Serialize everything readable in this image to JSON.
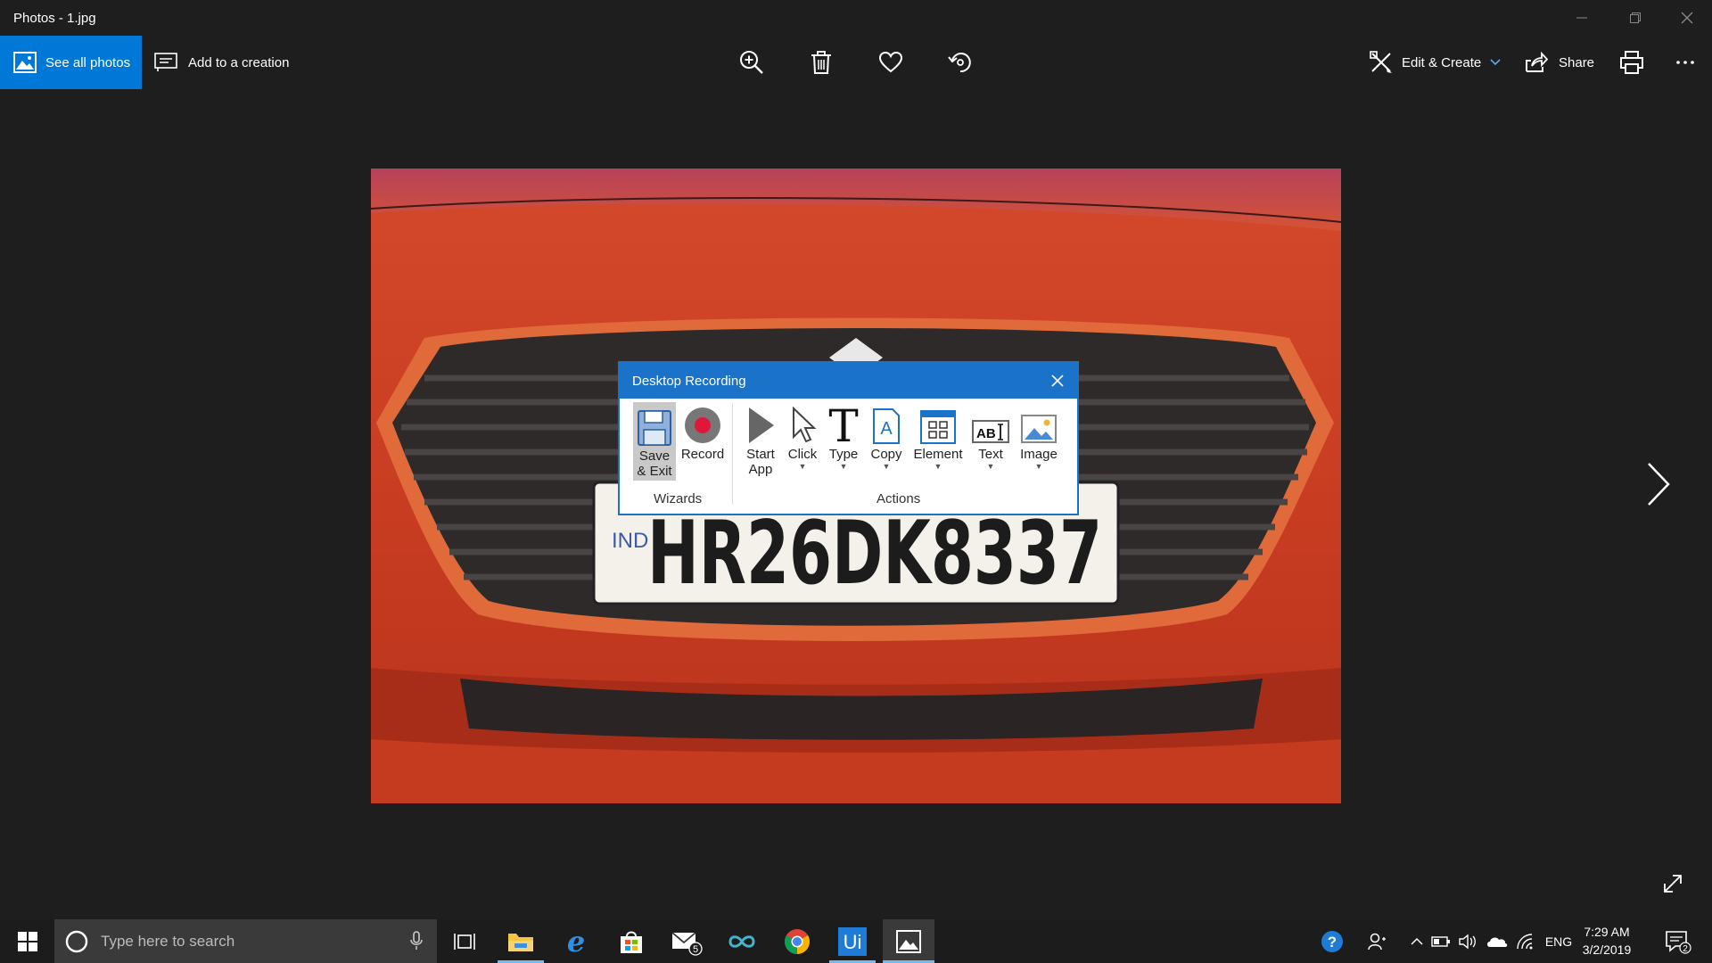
{
  "window": {
    "title": "Photos - 1.jpg"
  },
  "toolbar": {
    "see_all_label": "See all photos",
    "add_creation_label": "Add to a creation",
    "edit_create_label": "Edit & Create",
    "share_label": "Share"
  },
  "photo": {
    "plate_prefix": "IND",
    "plate_number": "HR26DK8337"
  },
  "recording_dialog": {
    "title": "Desktop Recording",
    "buttons": {
      "save_exit_1": "Save",
      "save_exit_2": "& Exit",
      "record": "Record",
      "start_app_1": "Start",
      "start_app_2": "App",
      "click": "Click",
      "type": "Type",
      "copy": "Copy",
      "element": "Element",
      "text": "Text",
      "image": "Image"
    },
    "groups": {
      "wizards": "Wizards",
      "actions": "Actions"
    }
  },
  "taskbar": {
    "search_placeholder": "Type here to search",
    "mail_badge": "5",
    "language": "ENG",
    "time": "7:29 AM",
    "date": "3/2/2019",
    "notification_count": "2"
  },
  "colors": {
    "accent": "#0078d7",
    "dialog_blue": "#1a73c8",
    "record_red": "#e0173a"
  }
}
